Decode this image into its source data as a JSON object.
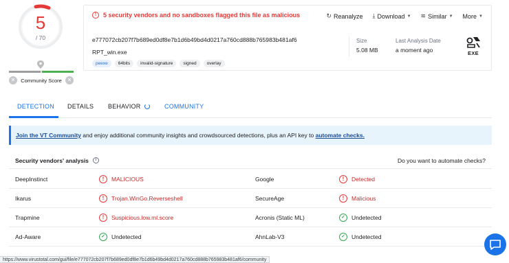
{
  "score": {
    "detections": "5",
    "total": "/ 70"
  },
  "community": {
    "label": "Community Score"
  },
  "alert": {
    "text": "5 security vendors and no sandboxes flagged this file as malicious"
  },
  "actions": [
    {
      "label": "Reanalyze",
      "icon": "reanalyze-icon"
    },
    {
      "label": "Download",
      "icon": "download-icon"
    },
    {
      "label": "Similar",
      "icon": "similar-icon"
    },
    {
      "label": "More",
      "icon": "more-icon"
    }
  ],
  "file": {
    "hash": "e777072cb207f7b689ed0df8e7b1d6b49bd4d0217a760cd888b765983b481af6",
    "name": "RPT_win.exe",
    "tags": [
      "peexe",
      "64bits",
      "invalid-signature",
      "signed",
      "overlay"
    ],
    "size_label": "Size",
    "size_value": "5.08 MB",
    "analysis_label": "Last Analysis Date",
    "analysis_value": "a moment ago",
    "type": "EXE"
  },
  "tabs": [
    {
      "label": "DETECTION",
      "state": "active"
    },
    {
      "label": "DETAILS",
      "state": "normal"
    },
    {
      "label": "BEHAVIOR",
      "state": "loading"
    },
    {
      "label": "COMMUNITY",
      "state": "link"
    }
  ],
  "banner": {
    "link1": "Join the VT Community",
    "middle": " and enjoy additional community insights and crowdsourced detections, plus an API key to ",
    "link2": "automate checks."
  },
  "vendors_section": {
    "title": "Security vendors' analysis",
    "right": "Do you want to automate checks?"
  },
  "vendors": [
    {
      "left": {
        "name": "DeepInstinct",
        "result": "MALICIOUS",
        "status": "malicious"
      },
      "right": {
        "name": "Google",
        "result": "Detected",
        "status": "malicious"
      }
    },
    {
      "left": {
        "name": "Ikarus",
        "result": "Trojan.WinGo.Reverseshell",
        "status": "malicious"
      },
      "right": {
        "name": "SecureAge",
        "result": "Malicious",
        "status": "malicious"
      }
    },
    {
      "left": {
        "name": "Trapmine",
        "result": "Suspicious.low.ml.score",
        "status": "malicious"
      },
      "right": {
        "name": "Acronis (Static ML)",
        "result": "Undetected",
        "status": "clean"
      }
    },
    {
      "left": {
        "name": "Ad-Aware",
        "result": "Undetected",
        "status": "clean"
      },
      "right": {
        "name": "AhnLab-V3",
        "result": "Undetected",
        "status": "clean"
      }
    }
  ],
  "status_url": "https://www.virustotal.com/gui/file/e777072cb207f7b689ed0df8e7b1d6b49bd4d0217a760cd888b765983b481af6/community",
  "colors": {
    "malicious": "#e53935",
    "clean": "#34a853",
    "accent": "#1a73e8"
  }
}
